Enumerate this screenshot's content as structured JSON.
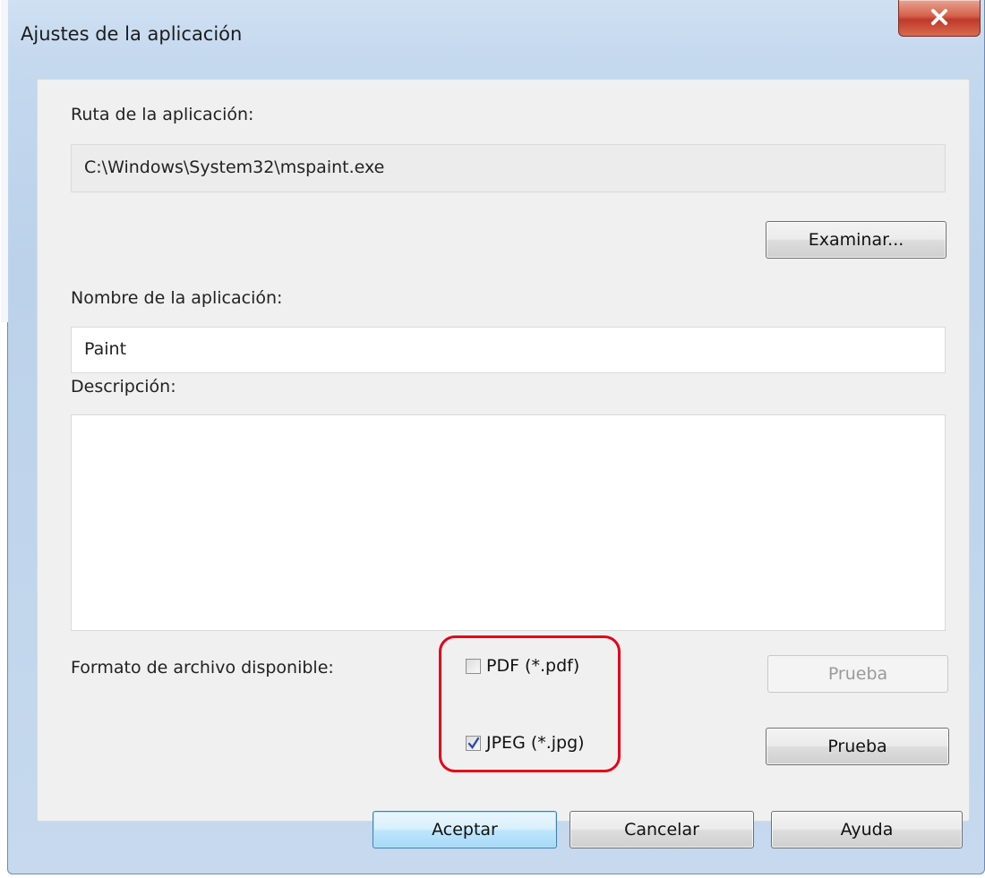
{
  "window": {
    "title": "Ajustes de la aplicación"
  },
  "path": {
    "label": "Ruta de la aplicación:",
    "value": "C:\\Windows\\System32\\mspaint.exe"
  },
  "browse_button": "Examinar...",
  "name": {
    "label": "Nombre de la aplicación:",
    "value": "Paint"
  },
  "description": {
    "label": "Descripción:",
    "value": ""
  },
  "formats": {
    "label": "Formato de archivo disponible:",
    "pdf": {
      "label": "PDF (*.pdf)",
      "checked": false,
      "test_button": "Prueba",
      "test_enabled": false
    },
    "jpeg": {
      "label": "JPEG (*.jpg)",
      "checked": true,
      "test_button": "Prueba",
      "test_enabled": true
    }
  },
  "footer": {
    "ok": "Aceptar",
    "cancel": "Cancelar",
    "help": "Ayuda"
  },
  "colors": {
    "highlight": "#e3001b",
    "close": "#c0392b",
    "check": "#2a4ea8"
  }
}
